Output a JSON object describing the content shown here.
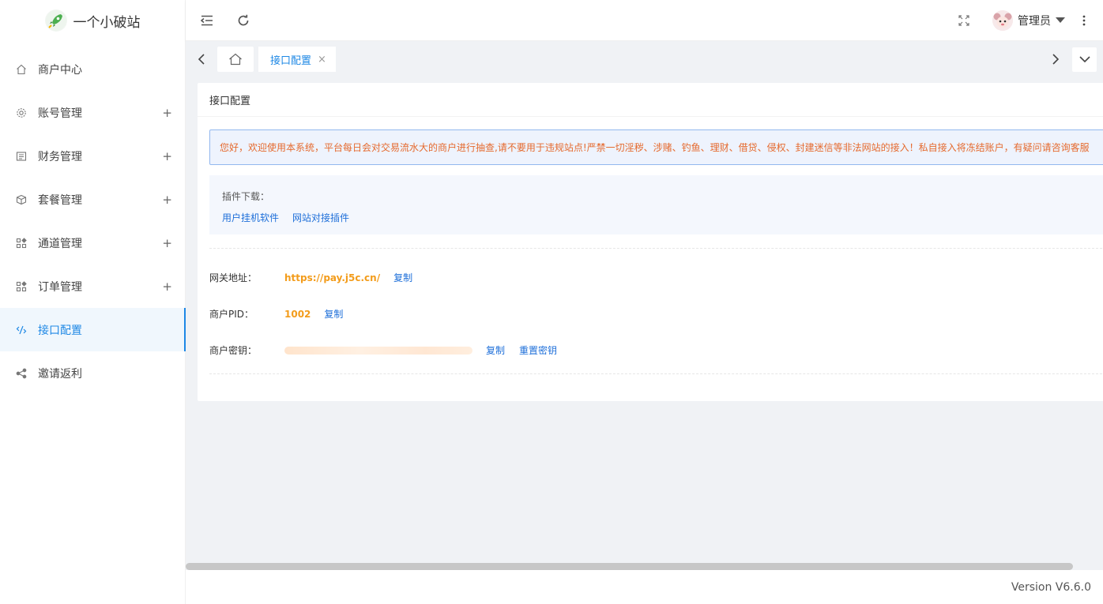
{
  "app": {
    "title": "一个小破站"
  },
  "sidebar": {
    "items": [
      {
        "label": "商户中心",
        "icon": "home-icon",
        "expandable": false,
        "active": false
      },
      {
        "label": "账号管理",
        "icon": "gear-icon",
        "expandable": true,
        "active": false
      },
      {
        "label": "财务管理",
        "icon": "finance-icon",
        "expandable": true,
        "active": false
      },
      {
        "label": "套餐管理",
        "icon": "package-icon",
        "expandable": true,
        "active": false
      },
      {
        "label": "通道管理",
        "icon": "grid-icon",
        "expandable": true,
        "active": false
      },
      {
        "label": "订单管理",
        "icon": "grid-icon",
        "expandable": true,
        "active": false
      },
      {
        "label": "接口配置",
        "icon": "api-icon",
        "expandable": false,
        "active": true
      },
      {
        "label": "邀请返利",
        "icon": "share-icon",
        "expandable": false,
        "active": false
      }
    ],
    "expand_symbol": "+"
  },
  "header": {
    "user_name": "管理员",
    "icons": [
      "menu-fold-icon",
      "refresh-icon",
      "fullscreen-icon",
      "more-vertical-icon",
      "caret-down-icon"
    ]
  },
  "tabs": {
    "active_label": "接口配置",
    "close_symbol": "×"
  },
  "card": {
    "title": "接口配置",
    "notice": "您好，欢迎使用本系统，平台每日会对交易流水大的商户进行抽查,请不要用于违规站点!严禁一切淫秽、涉赌、钓鱼、理财、借贷、侵权、封建迷信等非法网站的接入！私自接入将冻结账户，有疑问请咨询客服",
    "plugins": {
      "title": "插件下载：",
      "links": [
        "用户挂机软件",
        "网站对接插件"
      ]
    },
    "gateway": {
      "label": "网关地址：",
      "value": "https://pay.j5c.cn/",
      "copy": "复制"
    },
    "pid": {
      "label": "商户PID：",
      "value": "1002",
      "copy": "复制"
    },
    "secret": {
      "label": "商户密钥：",
      "copy": "复制",
      "reset": "重置密钥"
    }
  },
  "footer": {
    "version": "Version V6.6.0"
  },
  "colors": {
    "accent": "#1e88e5",
    "warning_text": "#e56a2e",
    "value_orange": "#f39c1b",
    "notice_border": "#93b8ef"
  }
}
